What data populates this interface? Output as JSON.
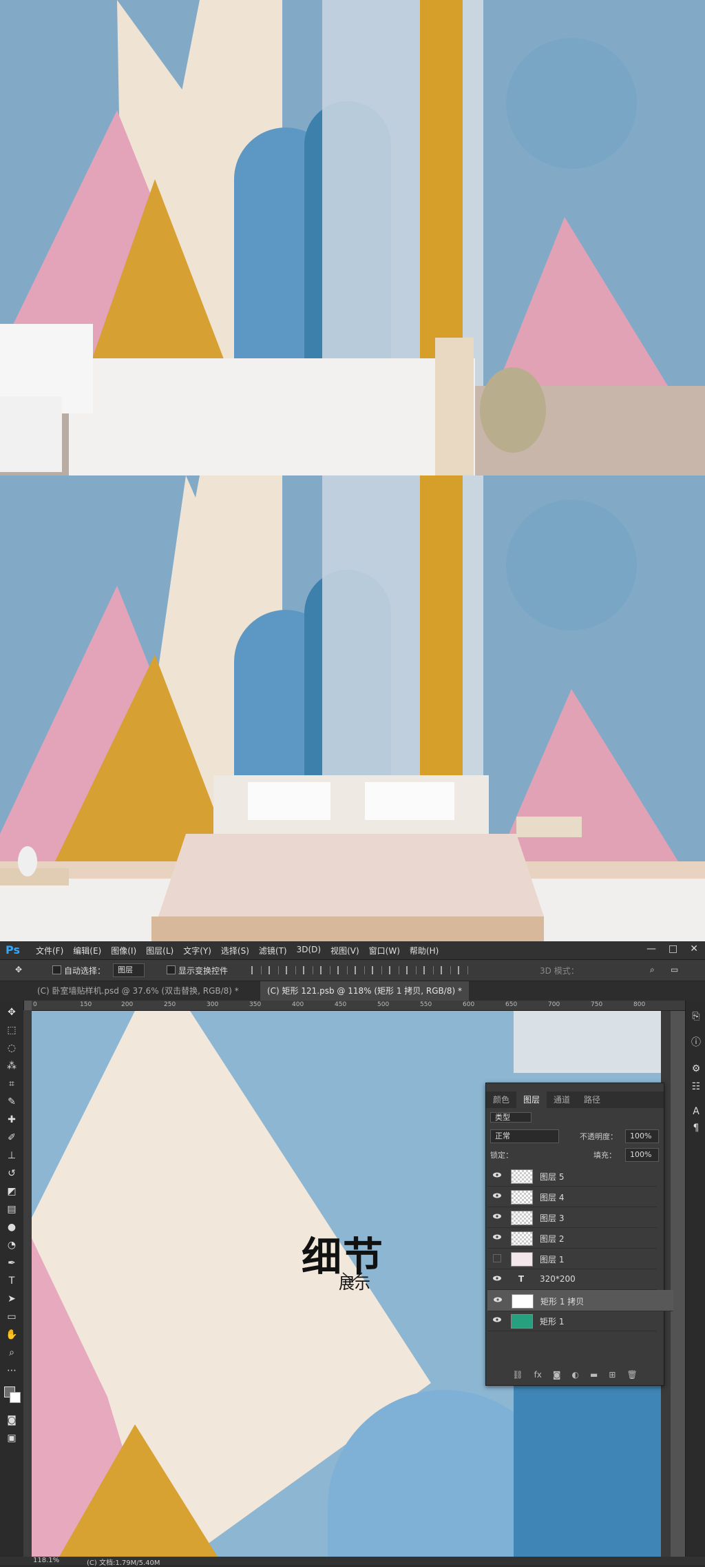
{
  "app": {
    "logo": "Ps",
    "menus": [
      "文件(F)",
      "编辑(E)",
      "图像(I)",
      "图层(L)",
      "文字(Y)",
      "选择(S)",
      "滤镜(T)",
      "3D(D)",
      "视图(V)",
      "窗口(W)",
      "帮助(H)"
    ],
    "window_controls": [
      "—",
      "□",
      "✕"
    ]
  },
  "options": {
    "auto_select_label": "自动选择：",
    "auto_select_value": "图层",
    "show_transform_label": "显示变换控件",
    "mode_3d_label": "3D 模式："
  },
  "tabs": [
    {
      "label": "(C) 卧室墙贴样机.psd @ 37.6% (双击替换, RGB/8) *"
    },
    {
      "label": "(C) 矩形 121.psb @ 118% (矩形 1 拷贝, RGB/8) *"
    }
  ],
  "ruler": {
    "h_ticks": [
      "0",
      "150",
      "200",
      "250",
      "300",
      "350",
      "400",
      "450",
      "500",
      "550",
      "600",
      "650",
      "700",
      "750",
      "800"
    ]
  },
  "canvas": {
    "title": "细节",
    "subtitle": "展示"
  },
  "layers_panel": {
    "tabs": [
      "颜色",
      "图层",
      "通道",
      "路径"
    ],
    "active_tab": "图层",
    "filter_label": "类型",
    "blend_mode": "正常",
    "opacity_label": "不透明度：",
    "opacity_value": "100%",
    "lock_label": "锁定：",
    "fill_label": "填充：",
    "fill_value": "100%",
    "layers": [
      {
        "name": "图层 5",
        "visible": true,
        "thumb": "checker"
      },
      {
        "name": "图层 4",
        "visible": true,
        "thumb": "checker"
      },
      {
        "name": "图层 3",
        "visible": true,
        "thumb": "checker"
      },
      {
        "name": "图层 2",
        "visible": true,
        "thumb": "checker"
      },
      {
        "name": "图层 1",
        "visible": false,
        "thumb": "pattern"
      },
      {
        "name": "320*200",
        "visible": true,
        "thumb": "text"
      },
      {
        "name": "矩形 1 拷贝",
        "visible": true,
        "thumb": "white",
        "selected": true
      },
      {
        "name": "矩形 1",
        "visible": true,
        "thumb": "green"
      }
    ],
    "footer_icons": [
      "link-icon",
      "fx-icon",
      "mask-icon",
      "adjustment-icon",
      "folder-icon",
      "new-layer-icon",
      "trash-icon"
    ]
  },
  "status": {
    "zoom": "118.1%",
    "doc": "(C) 文档:1.79M/5.40M"
  },
  "colors": {
    "wall_blue": "#7fa8c6",
    "pink": "#e3a2b8",
    "gold": "#d8a232",
    "cream": "#efe5d8",
    "dark_blue": "#3d7faa",
    "ps_accent": "#31a8ff"
  }
}
